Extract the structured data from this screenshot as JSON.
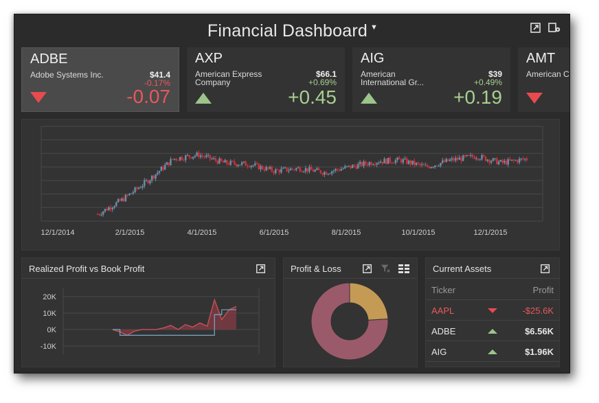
{
  "dashboard": {
    "title": "Financial Dashboard",
    "title_caret": "▼",
    "icons": [
      "export-icon",
      "settings-icon"
    ]
  },
  "tickers": [
    {
      "symbol": "ADBE",
      "name": "Adobe Systems Inc.",
      "price": "$41.4",
      "pct": "-0.17%",
      "change": "-0.07",
      "direction": "down",
      "selected": true
    },
    {
      "symbol": "AXP",
      "name": "American Express Company",
      "price": "$66.1",
      "pct": "+0.69%",
      "change": "+0.45",
      "direction": "up",
      "selected": false
    },
    {
      "symbol": "AIG",
      "name": "American International Gr...",
      "price": "$39",
      "pct": "+0.49%",
      "change": "+0.19",
      "direction": "up",
      "selected": false
    },
    {
      "symbol": "AMT",
      "name": "American Corpor...",
      "price": "",
      "pct": "",
      "change": "",
      "direction": "down",
      "selected": false
    }
  ],
  "stock_chart": {
    "x_labels": [
      "12/1/2014",
      "2/1/2015",
      "4/1/2015",
      "6/1/2015",
      "8/1/2015",
      "10/1/2015",
      "12/1/2015"
    ]
  },
  "panels": {
    "realized": {
      "title": "Realized Profit vs Book Profit",
      "y_labels": [
        "20K",
        "10K",
        "0K",
        "-10K"
      ]
    },
    "pnl": {
      "title": "Profit & Loss"
    },
    "assets": {
      "title": "Current Assets",
      "col_ticker": "Ticker",
      "col_profit": "Profit",
      "rows": [
        {
          "ticker": "AAPL",
          "profit": "-$25.6K",
          "direction": "down"
        },
        {
          "ticker": "ADBE",
          "profit": "$6.56K",
          "direction": "up"
        },
        {
          "ticker": "AIG",
          "profit": "$1.96K",
          "direction": "up"
        }
      ]
    }
  },
  "chart_data": [
    {
      "type": "line",
      "title": "",
      "xlabel": "",
      "ylabel": "",
      "x": [
        "12/1/2014",
        "2/1/2015",
        "4/1/2015",
        "6/1/2015",
        "8/1/2015",
        "10/1/2015",
        "12/1/2015"
      ],
      "ylim": [
        0,
        7
      ],
      "grid": true,
      "series": [
        {
          "name": "",
          "values": [
            0.5,
            1.6,
            3.0,
            4.6,
            4.9,
            4.3,
            4.2,
            3.7,
            3.9,
            3.6,
            4.0,
            4.4,
            4.5,
            4.0,
            4.5,
            4.8,
            4.3,
            4.6
          ]
        }
      ]
    },
    {
      "type": "line",
      "title": "Realized Profit vs Book Profit",
      "ylim": [
        -15000,
        25000
      ],
      "y_ticks": [
        "20K",
        "10K",
        "0K",
        "-10K"
      ],
      "series": [
        {
          "name": "",
          "values": [
            0,
            -1500,
            -3500,
            -1000,
            0,
            0,
            0,
            1000,
            2500,
            0,
            3000,
            1500,
            4000,
            2000,
            18000,
            6000,
            12000,
            14000
          ]
        },
        {
          "name": "",
          "values": [
            0,
            -3500,
            -3500,
            -3500,
            -3500,
            -3500,
            -3500,
            -3500,
            -3500,
            -3500,
            -3500,
            -3500,
            -3500,
            -3500,
            9000,
            12000,
            12000,
            12000
          ]
        }
      ],
      "colors": [
        "#c0505a",
        "#7aa8c8"
      ]
    },
    {
      "type": "pie",
      "title": "Profit & Loss",
      "labels": [
        "",
        ""
      ],
      "values": [
        76,
        24
      ],
      "colors": [
        "#9b5a6a",
        "#c49a55"
      ],
      "donut": true
    }
  ]
}
